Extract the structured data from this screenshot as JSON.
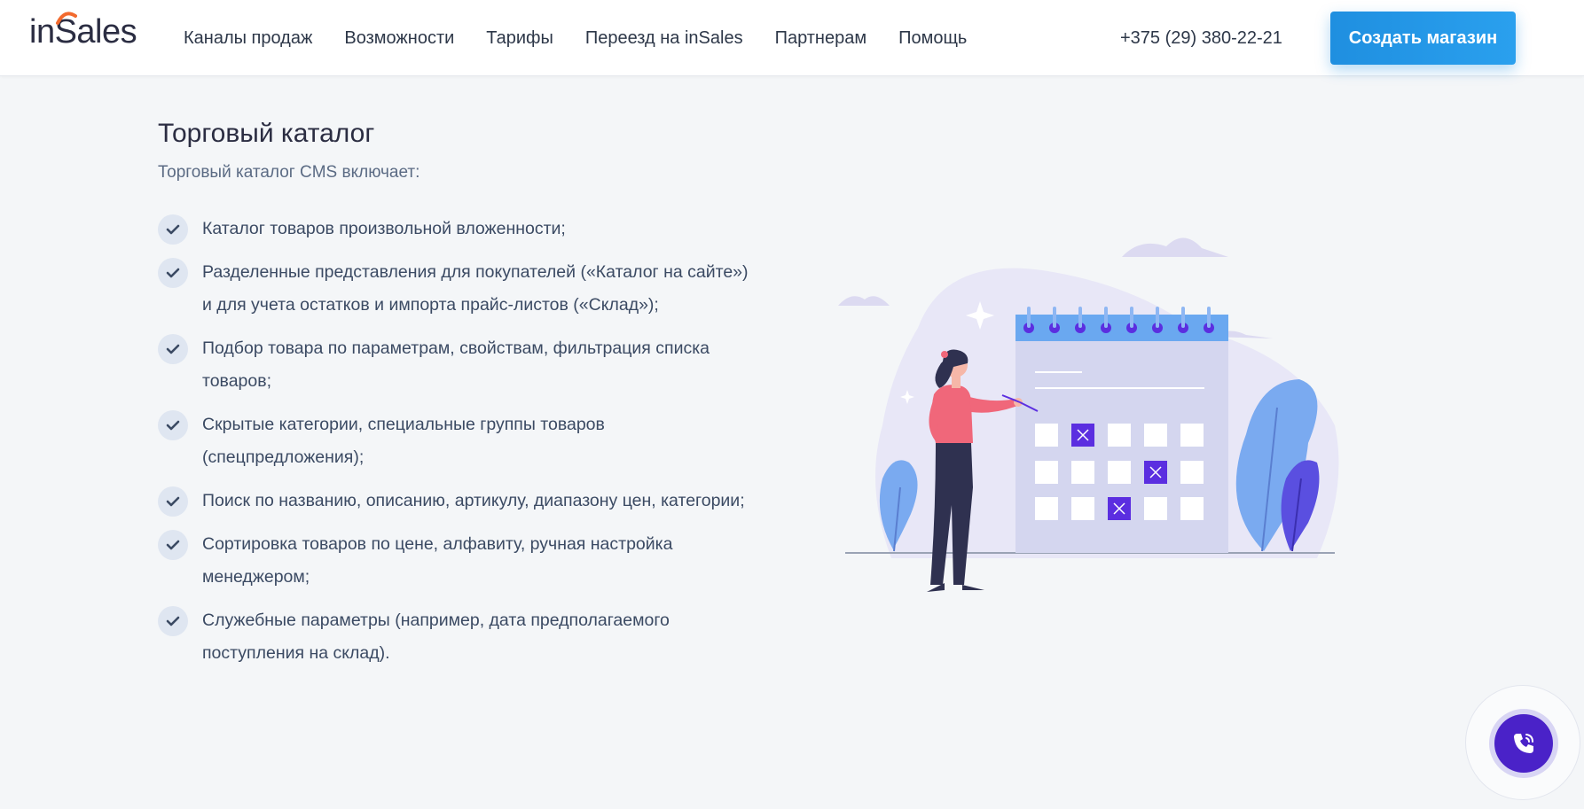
{
  "header": {
    "logo": "inSales",
    "nav": [
      "Каналы продаж",
      "Возможности",
      "Тарифы",
      "Переезд на inSales",
      "Партнерам",
      "Помощь"
    ],
    "phone": "+375 (29) 380-22-21",
    "cta_label": "Создать магазин"
  },
  "main": {
    "title": "Торговый каталог",
    "subtitle": "Торговый каталог CMS включает:",
    "features": [
      "Каталог товаров произвольной вложенности;",
      "Разделенные представления для покупателей («Каталог на сайте») и для учета остатков и импорта прайс-листов («Склад»);",
      "Подбор товара по параметрам, свойствам, фильтрация списка товаров;",
      "Скрытые категории, специальные группы товаров (спецпредложения);",
      "Поиск по названию, описанию, артикулу, диапазону цен, категории;",
      "Сортировка товаров по цене, алфавиту, ручная настройка менеджером;",
      "Служебные параметры (например, дата предполагаемого поступления на склад)."
    ]
  },
  "icons": {
    "check": "check-icon",
    "phone": "phone-icon",
    "illustration": "calendar-illustration"
  },
  "colors": {
    "accent": "#2196e3",
    "check_bg": "#dfe6f1",
    "call_button": "#4a22c8",
    "calendar_mark": "#5b2ee0"
  }
}
